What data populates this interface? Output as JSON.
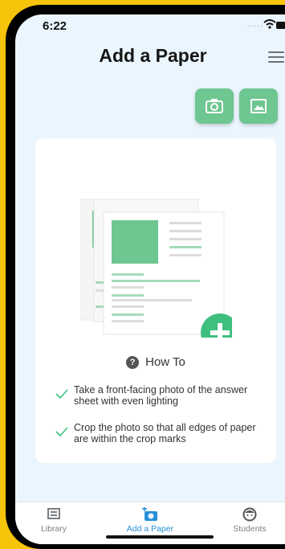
{
  "status": {
    "time": "6:22",
    "dots": "....."
  },
  "header": {
    "title": "Add a Paper"
  },
  "actions": {
    "camera_icon": "camera-icon",
    "gallery_icon": "image-icon"
  },
  "card": {
    "howto_label": "How To",
    "tips": [
      "Take a front-facing photo of the answer sheet with even lighting",
      "Crop the photo so that all edges of paper are within the crop marks"
    ]
  },
  "tabs": [
    {
      "label": "Library",
      "icon": "library-icon"
    },
    {
      "label": "Add a Paper",
      "icon": "camera-plus-icon"
    },
    {
      "label": "Students",
      "icon": "student-face-icon"
    }
  ],
  "colors": {
    "accent_green": "#6ec691",
    "active_tab": "#2790d8",
    "background": "#eaf5fd"
  }
}
